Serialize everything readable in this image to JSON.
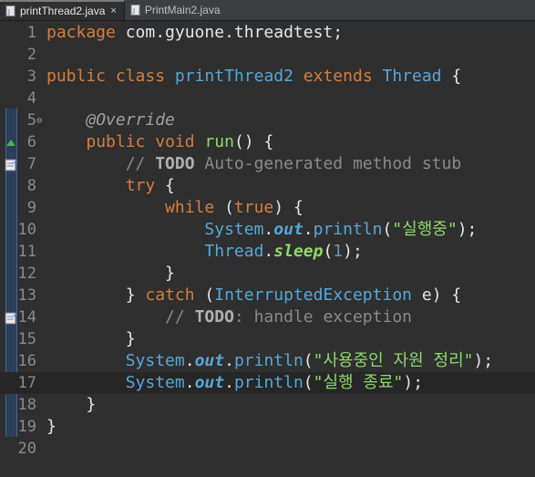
{
  "tabs": [
    {
      "label": "printThread2.java",
      "active": true,
      "close": "×"
    },
    {
      "label": "PrintMain2.java",
      "active": false
    }
  ],
  "lines": [
    {
      "n": "1",
      "tokens": [
        [
          "kw",
          "package"
        ],
        [
          "pl",
          " com.gyuone.threadtest;"
        ]
      ]
    },
    {
      "n": "2",
      "tokens": []
    },
    {
      "n": "3",
      "tokens": [
        [
          "kw",
          "public"
        ],
        [
          "pl",
          " "
        ],
        [
          "kw",
          "class"
        ],
        [
          "pl",
          " "
        ],
        [
          "cls",
          "printThread2"
        ],
        [
          "pl",
          " "
        ],
        [
          "kw",
          "extends"
        ],
        [
          "pl",
          " "
        ],
        [
          "cls",
          "Thread"
        ],
        [
          "pl",
          " {"
        ]
      ]
    },
    {
      "n": "4",
      "tokens": []
    },
    {
      "n": "5",
      "fold": true,
      "tokens": [
        [
          "pl",
          "    "
        ],
        [
          "ann",
          "@Override"
        ]
      ]
    },
    {
      "n": "6",
      "tokens": [
        [
          "pl",
          "    "
        ],
        [
          "kw",
          "public"
        ],
        [
          "pl",
          " "
        ],
        [
          "kw",
          "void"
        ],
        [
          "pl",
          " "
        ],
        [
          "mdecl",
          "run"
        ],
        [
          "pl",
          "() {"
        ]
      ]
    },
    {
      "n": "7",
      "tokens": [
        [
          "pl",
          "        "
        ],
        [
          "cm",
          "// "
        ],
        [
          "todo",
          "TODO"
        ],
        [
          "cm",
          " Auto-generated method stub"
        ]
      ]
    },
    {
      "n": "8",
      "tokens": [
        [
          "pl",
          "        "
        ],
        [
          "kw",
          "try"
        ],
        [
          "pl",
          " {"
        ]
      ]
    },
    {
      "n": "9",
      "tokens": [
        [
          "pl",
          "            "
        ],
        [
          "kw",
          "while"
        ],
        [
          "pl",
          " ("
        ],
        [
          "kw",
          "true"
        ],
        [
          "pl",
          ") {"
        ]
      ]
    },
    {
      "n": "10",
      "tokens": [
        [
          "pl",
          "                "
        ],
        [
          "cls",
          "System"
        ],
        [
          "pl",
          "."
        ],
        [
          "fld",
          "out"
        ],
        [
          "pl",
          "."
        ],
        [
          "mth",
          "println"
        ],
        [
          "pl",
          "("
        ],
        [
          "str",
          "\"실행중\""
        ],
        [
          "pl",
          ");"
        ]
      ]
    },
    {
      "n": "11",
      "tokens": [
        [
          "pl",
          "                "
        ],
        [
          "cls",
          "Thread"
        ],
        [
          "pl",
          "."
        ],
        [
          "smth",
          "sleep"
        ],
        [
          "pl",
          "("
        ],
        [
          "num",
          "1"
        ],
        [
          "pl",
          ");"
        ]
      ]
    },
    {
      "n": "12",
      "tokens": [
        [
          "pl",
          "            }"
        ]
      ]
    },
    {
      "n": "13",
      "tokens": [
        [
          "pl",
          "        } "
        ],
        [
          "kw",
          "catch"
        ],
        [
          "pl",
          " ("
        ],
        [
          "cls",
          "InterruptedException"
        ],
        [
          "pl",
          " "
        ],
        [
          "var",
          "e"
        ],
        [
          "pl",
          ") {"
        ]
      ]
    },
    {
      "n": "14",
      "tokens": [
        [
          "pl",
          "            "
        ],
        [
          "cm",
          "// "
        ],
        [
          "todo",
          "TODO"
        ],
        [
          "cm",
          ": handle exception"
        ]
      ]
    },
    {
      "n": "15",
      "tokens": [
        [
          "pl",
          "        }"
        ]
      ]
    },
    {
      "n": "16",
      "tokens": [
        [
          "pl",
          "        "
        ],
        [
          "cls",
          "System"
        ],
        [
          "pl",
          "."
        ],
        [
          "fld",
          "out"
        ],
        [
          "pl",
          "."
        ],
        [
          "mth",
          "println"
        ],
        [
          "pl",
          "("
        ],
        [
          "str",
          "\"사용중인 자원 정리\""
        ],
        [
          "pl",
          ");"
        ]
      ]
    },
    {
      "n": "17",
      "current": true,
      "tokens": [
        [
          "pl",
          "        "
        ],
        [
          "cls",
          "System"
        ],
        [
          "pl",
          "."
        ],
        [
          "fld",
          "out"
        ],
        [
          "pl",
          "."
        ],
        [
          "mth",
          "println"
        ],
        [
          "pl",
          "("
        ],
        [
          "str",
          "\"실행 종료\""
        ],
        [
          "pl",
          ");"
        ]
      ]
    },
    {
      "n": "18",
      "tokens": [
        [
          "pl",
          "    }"
        ]
      ]
    },
    {
      "n": "19",
      "tokens": [
        [
          "pl",
          "}"
        ]
      ]
    },
    {
      "n": "20",
      "tokens": []
    }
  ],
  "gutter_icons": [
    {
      "line": "6",
      "icon": "override-triangle-icon",
      "color": "#4caf50"
    },
    {
      "line": "7",
      "icon": "task-marker-icon",
      "color": "#5b8fd6"
    },
    {
      "line": "14",
      "icon": "task-marker-icon",
      "color": "#5b8fd6"
    }
  ],
  "colors": {
    "keyword": "#d97d3b",
    "type": "#56a7d8",
    "string": "#8fd86a",
    "comment": "#8a8a8a",
    "background": "#2f2f2f"
  }
}
